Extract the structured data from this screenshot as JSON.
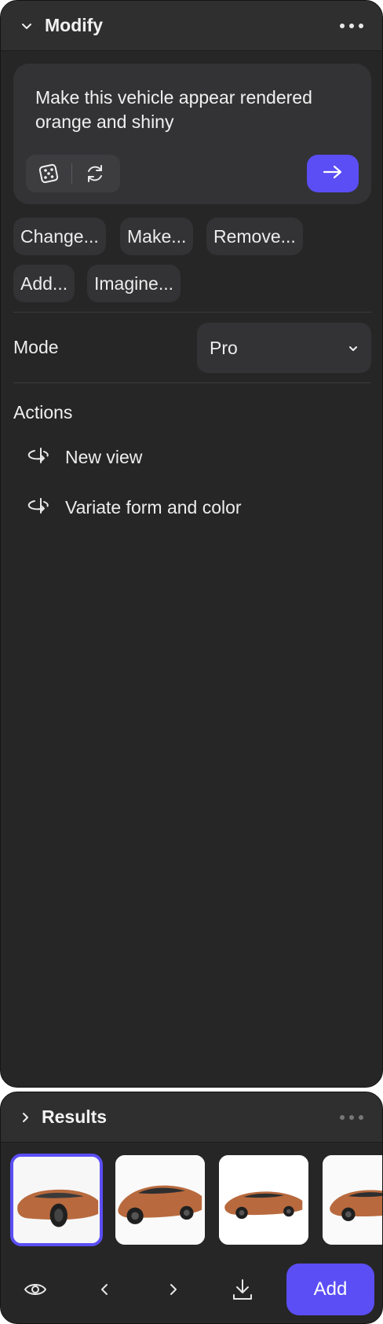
{
  "modify": {
    "title": "Modify",
    "prompt": "Make this vehicle appear rendered orange and shiny",
    "chips": [
      "Change...",
      "Make...",
      "Remove...",
      "Add...",
      "Imagine..."
    ],
    "mode_label": "Mode",
    "mode_value": "Pro",
    "actions_title": "Actions",
    "actions": [
      "New view",
      "Variate form and color"
    ]
  },
  "results": {
    "title": "Results",
    "thumbnails": [
      "car-thumbnail-1",
      "car-thumbnail-2",
      "car-thumbnail-3",
      "car-thumbnail-4"
    ],
    "selected_index": 0,
    "add_label": "Add"
  },
  "colors": {
    "accent": "#5b4ef5",
    "panel": "#262626",
    "surface": "#333335",
    "car": "#b86a3e"
  },
  "icons": [
    "chevron-down-icon",
    "more-icon",
    "dice-icon",
    "refresh-icon",
    "arrow-right-icon",
    "orbit-icon",
    "chevron-right-icon",
    "eye-icon",
    "chevron-left-icon",
    "download-icon"
  ]
}
